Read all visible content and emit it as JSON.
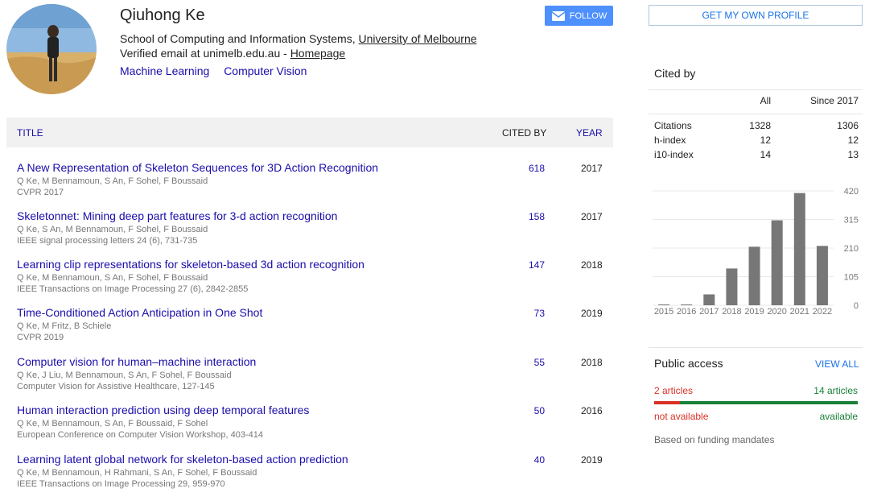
{
  "profile": {
    "name": "Qiuhong Ke",
    "affiliation_prefix": "School of Computing and Information Systems, ",
    "affiliation_link": "University of Melbourne",
    "email_prefix": "Verified email at unimelb.edu.au - ",
    "homepage": "Homepage",
    "interests": [
      "Machine Learning",
      "Computer Vision"
    ],
    "follow_label": "FOLLOW"
  },
  "table": {
    "headers": {
      "title": "TITLE",
      "cited_by": "CITED BY",
      "year": "YEAR"
    },
    "rows": [
      {
        "title": "A New Representation of Skeleton Sequences for 3D Action Recognition",
        "authors": "Q Ke, M Bennamoun, S An, F Sohel, F Boussaid",
        "venue": "CVPR 2017",
        "cited": "618",
        "year": "2017"
      },
      {
        "title": "Skeletonnet: Mining deep part features for 3-d action recognition",
        "authors": "Q Ke, S An, M Bennamoun, F Sohel, F Boussaid",
        "venue": "IEEE signal processing letters 24 (6), 731-735",
        "cited": "158",
        "year": "2017"
      },
      {
        "title": "Learning clip representations for skeleton-based 3d action recognition",
        "authors": "Q Ke, M Bennamoun, S An, F Sohel, F Boussaid",
        "venue": "IEEE Transactions on Image Processing 27 (6), 2842-2855",
        "cited": "147",
        "year": "2018"
      },
      {
        "title": "Time-Conditioned Action Anticipation in One Shot",
        "authors": "Q Ke, M Fritz, B Schiele",
        "venue": "CVPR 2019",
        "cited": "73",
        "year": "2019"
      },
      {
        "title": "Computer vision for human–machine interaction",
        "authors": "Q Ke, J Liu, M Bennamoun, S An, F Sohel, F Boussaid",
        "venue": "Computer Vision for Assistive Healthcare, 127-145",
        "cited": "55",
        "year": "2018"
      },
      {
        "title": "Human interaction prediction using deep temporal features",
        "authors": "Q Ke, M Bennamoun, S An, F Boussaid, F Sohel",
        "venue": "European Conference on Computer Vision Workshop, 403-414",
        "cited": "50",
        "year": "2016"
      },
      {
        "title": "Learning latent global network for skeleton-based action prediction",
        "authors": "Q Ke, M Bennamoun, H Rahmani, S An, F Sohel, F Boussaid",
        "venue": "IEEE Transactions on Image Processing 29, 959-970",
        "cited": "40",
        "year": "2019"
      }
    ]
  },
  "sidebar": {
    "get_profile": "GET MY OWN PROFILE",
    "cited_by_title": "Cited by",
    "col_all": "All",
    "col_since": "Since 2017",
    "metrics": [
      {
        "label": "Citations",
        "all": "1328",
        "since": "1306"
      },
      {
        "label": "h-index",
        "all": "12",
        "since": "12"
      },
      {
        "label": "i10-index",
        "all": "14",
        "since": "13"
      }
    ],
    "public_access": {
      "title": "Public access",
      "view_all": "VIEW ALL",
      "not_available_count": "2 articles",
      "available_count": "14 articles",
      "not_available_label": "not available",
      "available_label": "available",
      "based_on": "Based on funding mandates",
      "available_fraction": 0.875
    }
  },
  "chart_data": {
    "type": "bar",
    "categories": [
      "2015",
      "2016",
      "2017",
      "2018",
      "2019",
      "2020",
      "2021",
      "2022"
    ],
    "values": [
      3,
      3,
      40,
      135,
      215,
      312,
      412,
      218
    ],
    "yticks": [
      "420",
      "315",
      "210",
      "105",
      "0"
    ],
    "ylim": [
      0,
      420
    ],
    "grid": true,
    "bar_color": "#777777"
  }
}
